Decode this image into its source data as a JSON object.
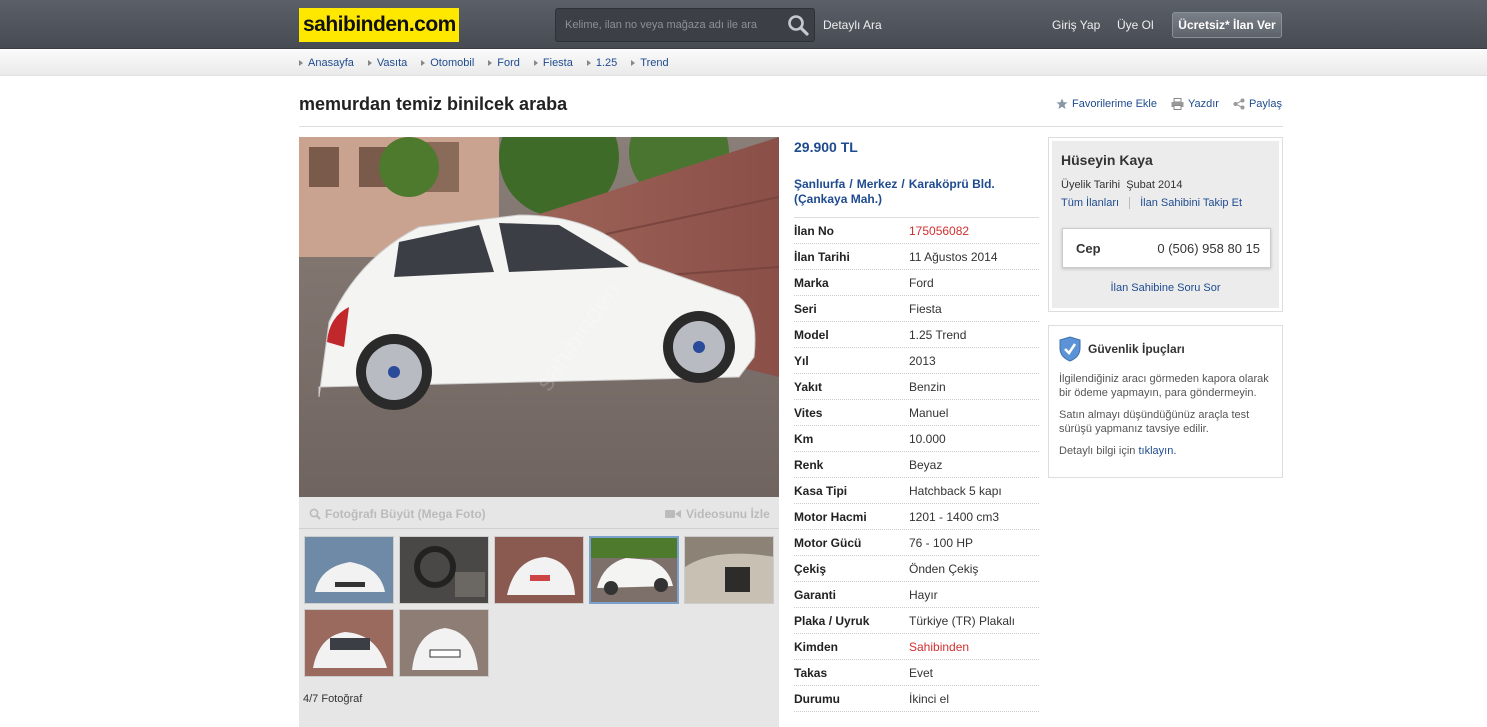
{
  "header": {
    "logo": "sahibinden.com",
    "search_placeholder": "Kelime, ilan no veya mağaza adı ile ara",
    "detayli_ara": "Detaylı Ara",
    "giris_yap": "Giriş Yap",
    "uye_ol": "Üye Ol",
    "ilan_ver": "Ücretsiz* İlan Ver"
  },
  "breadcrumb": [
    "Anasayfa",
    "Vasıta",
    "Otomobil",
    "Ford",
    "Fiesta",
    "1.25",
    "Trend"
  ],
  "listing": {
    "title": "memurdan temiz binilcek araba",
    "actions": {
      "favorite": "Favorilerime Ekle",
      "print": "Yazdır",
      "share": "Paylaş"
    },
    "price": "29.900 TL",
    "location": {
      "city": "Şanlıurfa",
      "district": "Merkez",
      "area": "Karaköprü Bld.",
      "neighborhood": "(Çankaya Mah.)"
    },
    "specs": [
      {
        "label": "İlan No",
        "value": "175056082",
        "highlight": true
      },
      {
        "label": "İlan Tarihi",
        "value": "11 Ağustos 2014"
      },
      {
        "label": "Marka",
        "value": "Ford"
      },
      {
        "label": "Seri",
        "value": "Fiesta"
      },
      {
        "label": "Model",
        "value": "1.25 Trend"
      },
      {
        "label": "Yıl",
        "value": "2013"
      },
      {
        "label": "Yakıt",
        "value": "Benzin"
      },
      {
        "label": "Vites",
        "value": "Manuel"
      },
      {
        "label": "Km",
        "value": "10.000"
      },
      {
        "label": "Renk",
        "value": "Beyaz"
      },
      {
        "label": "Kasa Tipi",
        "value": "Hatchback 5 kapı"
      },
      {
        "label": "Motor Hacmi",
        "value": "1201 - 1400 cm3"
      },
      {
        "label": "Motor Gücü",
        "value": "76 - 100 HP"
      },
      {
        "label": "Çekiş",
        "value": "Önden Çekiş"
      },
      {
        "label": "Garanti",
        "value": "Hayır"
      },
      {
        "label": "Plaka / Uyruk",
        "value": "Türkiye (TR) Plakalı"
      },
      {
        "label": "Kimden",
        "value": "Sahibinden",
        "highlight": true
      },
      {
        "label": "Takas",
        "value": "Evet"
      },
      {
        "label": "Durumu",
        "value": "İkinci el"
      }
    ]
  },
  "gallery": {
    "enlarge": "Fotoğrafı Büyüt (Mega Foto)",
    "video": "Videosunu İzle",
    "count": "4/7 Fotoğraf",
    "active_index": 3
  },
  "seller": {
    "name": "Hüseyin Kaya",
    "member_label": "Üyelik Tarihi",
    "member_since": "Şubat 2014",
    "all_listings": "Tüm İlanları",
    "follow": "İlan Sahibini Takip Et",
    "phone_label": "Cep",
    "phone": "0 (506) 958 80 15",
    "ask": "İlan Sahibine Soru Sor"
  },
  "safety": {
    "title": "Güvenlik İpuçları",
    "tip1": "İlgilendiğiniz aracı görmeden kapora olarak bir ödeme yapmayın, para göndermeyin.",
    "tip2": "Satın almayı düşündüğünüz araçla test sürüşü yapmanız tavsiye edilir.",
    "more_prefix": "Detaylı bilgi için",
    "more_link": "tıklayın."
  }
}
